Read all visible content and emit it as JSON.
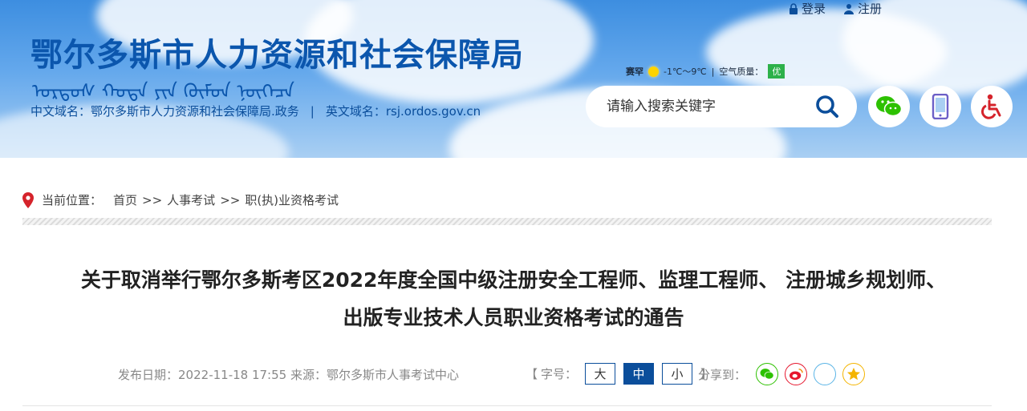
{
  "header": {
    "site_title": "鄂尔多斯市人力资源和社会保障局",
    "mongolian_script": "ᠣᠷᠳᠣᠰ ᠬᠣᠲᠠ ᠶᠢᠨ ᠬᠦᠮᠦᠨ ᠨᠥᠭᠡᠴᠡ",
    "cn_domain_label": "中文域名：",
    "cn_domain": "鄂尔多斯市人力资源和社会保障局.政务",
    "domain_sep": "|",
    "en_domain_label": "英文域名：",
    "en_domain": "rsj.ordos.gov.cn",
    "login": "登录",
    "register": "注册",
    "weather": {
      "city": "赛罕",
      "temp": "-1℃～9℃",
      "sep": "|",
      "aq_label": "空气质量：",
      "aq_value": "优"
    },
    "search_placeholder": "请输入搜索关键字"
  },
  "breadcrumb": {
    "label": "当前位置：",
    "items": [
      "首页",
      "人事考试",
      "职(执)业资格考试"
    ],
    "arrow": ">>"
  },
  "article": {
    "title_line1": "关于取消举行鄂尔多斯考区2022年度全国中级注册安全工程师、监理工程师、 注册城乡规划师、",
    "title_line2": "出版专业技术人员职业资格考试的通告",
    "date_label": "发布日期：",
    "date": "2022-11-18 17:55",
    "source_label": "来源：",
    "source": "鄂尔多斯市人事考试中心",
    "fontsize_open": "【",
    "fontsize_label": "字号：",
    "fontsize_large": "大",
    "fontsize_medium": "中",
    "fontsize_small": "小",
    "fontsize_close": "】",
    "share_label": "分享到："
  },
  "colors": {
    "brand": "#0b56ad",
    "accent": "#0b4e9b",
    "wechat": "#2dc100",
    "weibo": "#e6162d",
    "qzone": "#f4b400"
  }
}
